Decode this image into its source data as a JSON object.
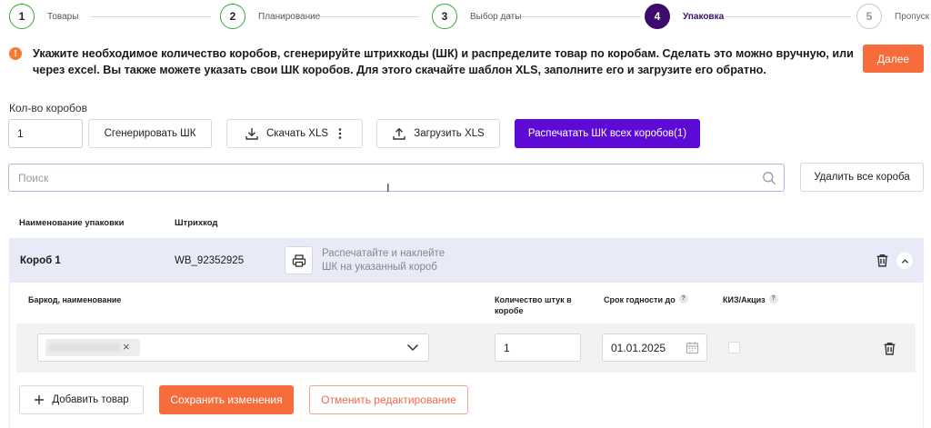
{
  "stepper": {
    "steps": [
      {
        "number": "1",
        "label": "Товары",
        "state": "done"
      },
      {
        "number": "2",
        "label": "Планирование",
        "state": "done"
      },
      {
        "number": "3",
        "label": "Выбор даты",
        "state": "done"
      },
      {
        "number": "4",
        "label": "Упаковка",
        "state": "active"
      },
      {
        "number": "5",
        "label": "Пропуск",
        "state": "pending"
      }
    ]
  },
  "alert": {
    "icon": "exclamation-icon",
    "text": "Укажите необходимое количество коробов, сгенерируйте штрихкоды (ШК) и распределите товар по коробам. Сделать это можно вручную, или через excel. Вы также можете указать свои ШК коробов. Для этого скачайте шаблон XLS, заполните его и загрузите его обратно.",
    "next_label": "Далее"
  },
  "toolbar": {
    "boxes_label": "Кол-во коробов",
    "boxes_value": "1",
    "generate_label": "Сгенерировать ШК",
    "download_label": "Скачать XLS",
    "upload_label": "Загрузить XLS",
    "print_all_label": "Распечатать ШК всех коробов(1)"
  },
  "search": {
    "placeholder": "Поиск",
    "delete_all_label": "Удалить все короба"
  },
  "table": {
    "col_name": "Наименование упаковки",
    "col_barcode": "Штрихкод",
    "box": {
      "name": "Короб 1",
      "barcode": "WB_92352925",
      "print_hint": "Распечатайте и наклейте ШК на указанный короб"
    },
    "sub_headers": {
      "barcode_name": "Баркод, наименование",
      "qty": "Количество штук в коробе",
      "expiry": "Срок годности до",
      "kiz": "КИЗ/Акциз",
      "help": "?"
    },
    "item": {
      "qty": "1",
      "expiry": "01.01.2025"
    }
  },
  "actions": {
    "add_label": "Добавить товар",
    "save_label": "Сохранить изменения",
    "cancel_label": "Отменить редактирование"
  },
  "colors": {
    "accent_orange": "#f66d3b",
    "accent_purple": "#5e0ad6",
    "step_done": "#36a83a",
    "step_active": "#3d0b6b",
    "box_row_bg": "#e8ebf7"
  }
}
